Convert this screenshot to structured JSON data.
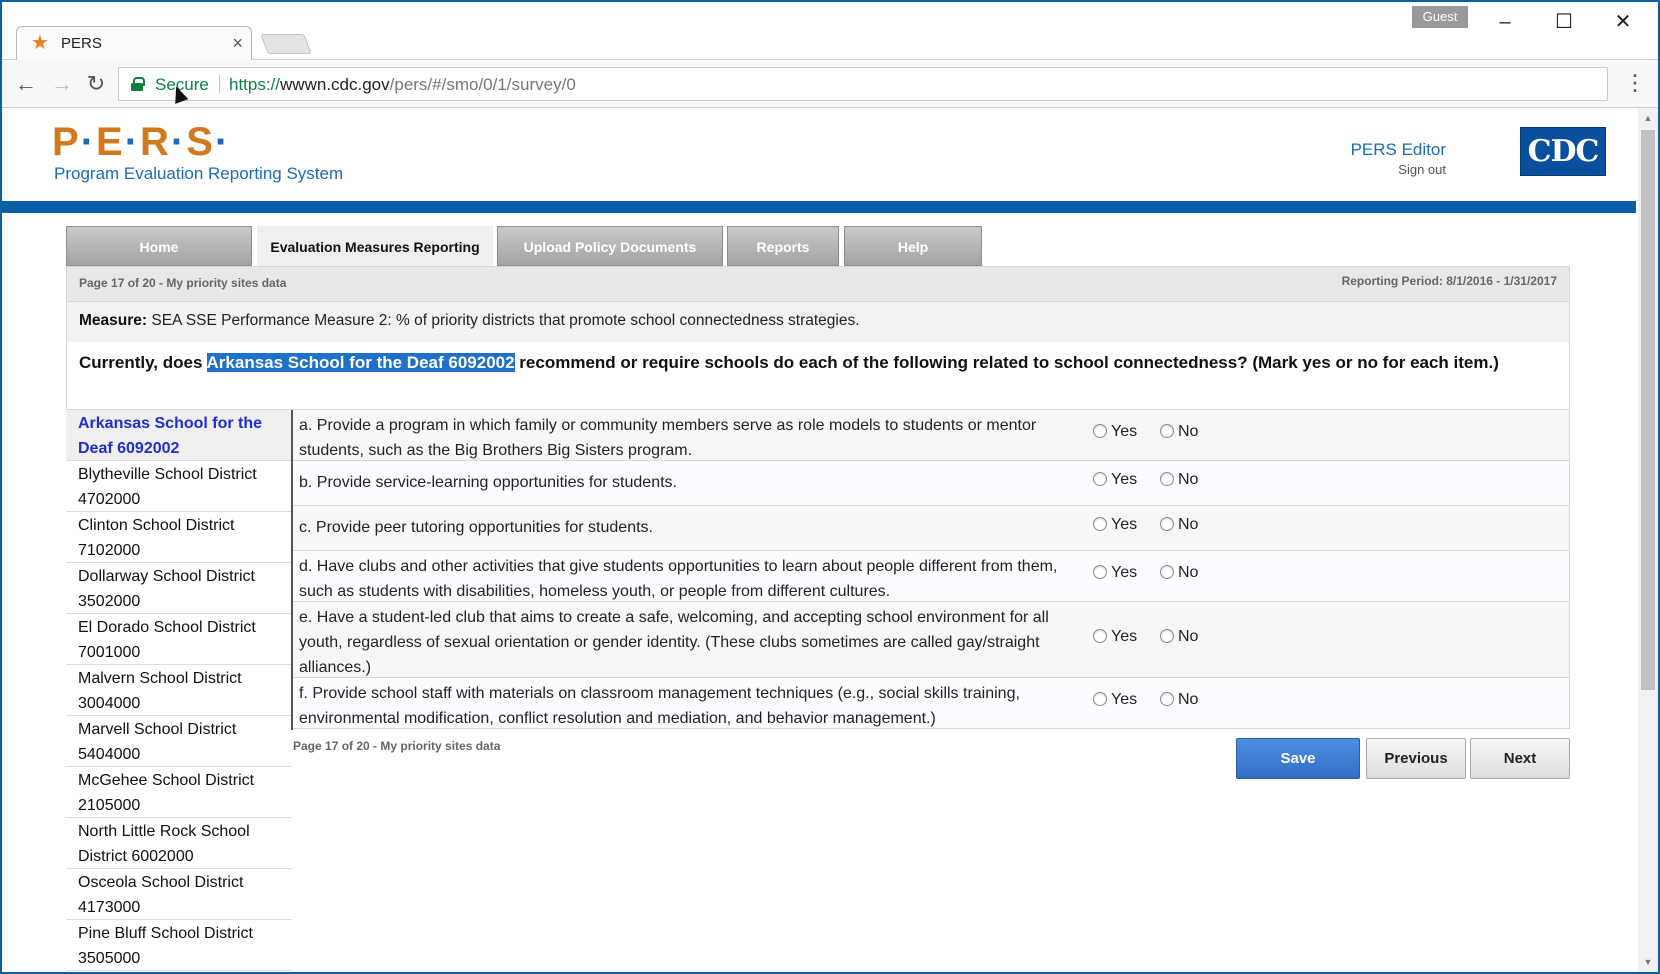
{
  "browser": {
    "tab_title": "PERS",
    "profile": "Guest",
    "secure_label": "Secure",
    "url_scheme": "https://",
    "url_host": "wwwn.cdc.gov",
    "url_path": "/pers/#/smo/0/1/survey/0"
  },
  "header": {
    "logo_letters": [
      "P",
      "E",
      "R",
      "S"
    ],
    "subtitle": "Program Evaluation Reporting System",
    "user_role": "PERS Editor",
    "sign_out": "Sign out",
    "agency_logo": "CDC"
  },
  "nav": {
    "tabs": [
      {
        "label": "Home",
        "active": false
      },
      {
        "label": "Evaluation Measures Reporting",
        "active": true
      },
      {
        "label": "Upload Policy Documents",
        "active": false
      },
      {
        "label": "Reports",
        "active": false
      },
      {
        "label": "Help",
        "active": false
      }
    ]
  },
  "page_info": {
    "page_label": "Page 17 of 20 - My priority sites data",
    "reporting_period": "Reporting Period: 8/1/2016 - 1/31/2017"
  },
  "measure": {
    "label": "Measure:",
    "text": "SEA SSE Performance Measure 2: % of priority districts that promote school connectedness strategies."
  },
  "question": {
    "prefix": "Currently, does",
    "site": "Arkansas School for the Deaf 6092002",
    "suffix": "recommend or require schools do each of the following related to school connectedness? (Mark yes or no for each item.)"
  },
  "sites": [
    {
      "name": "Arkansas School for the Deaf 6092002",
      "active": true
    },
    {
      "name": "Blytheville School District 4702000",
      "active": false
    },
    {
      "name": "Clinton School District 7102000",
      "active": false
    },
    {
      "name": "Dollarway School District 3502000",
      "active": false
    },
    {
      "name": "El Dorado School District 7001000",
      "active": false
    },
    {
      "name": "Malvern School District 3004000",
      "active": false
    },
    {
      "name": "Marvell School District 5404000",
      "active": false
    },
    {
      "name": "McGehee School District 2105000",
      "active": false
    },
    {
      "name": "North Little Rock School District 6002000",
      "active": false
    },
    {
      "name": "Osceola School District 4173000",
      "active": false
    },
    {
      "name": "Pine Bluff School District 3505000",
      "active": false
    }
  ],
  "items": [
    {
      "text": "a. Provide a program in which family or community members serve as role models to students or mentor students, such as the Big Brothers Big Sisters program.",
      "yes": "Yes",
      "no": "No"
    },
    {
      "text": "b. Provide service-learning opportunities for students.",
      "yes": "Yes",
      "no": "No"
    },
    {
      "text": "c. Provide peer tutoring opportunities for students.",
      "yes": "Yes",
      "no": "No"
    },
    {
      "text": "d. Have clubs and other activities that give students opportunities to learn about people different from them, such as students with disabilities, homeless youth, or people from different cultures.",
      "yes": "Yes",
      "no": "No"
    },
    {
      "text": "e. Have a student-led club that aims to create a safe, welcoming, and accepting school environment for all youth, regardless of sexual orientation or gender identity. (These clubs sometimes are called gay/straight alliances.)",
      "yes": "Yes",
      "no": "No"
    },
    {
      "text": "f. Provide school staff with materials on classroom management techniques (e.g., social skills training, environmental modification, conflict resolution and mediation, and behavior management.)",
      "yes": "Yes",
      "no": "No"
    }
  ],
  "footer": {
    "page_label": "Page 17 of 20 - My priority sites data",
    "save": "Save",
    "previous": "Previous",
    "next": "Next"
  },
  "colors": {
    "accent_blue": "#0a5ea8",
    "logo_orange": "#d2781f",
    "active_site": "#1f2ecc",
    "secure_green": "#0b8043"
  }
}
